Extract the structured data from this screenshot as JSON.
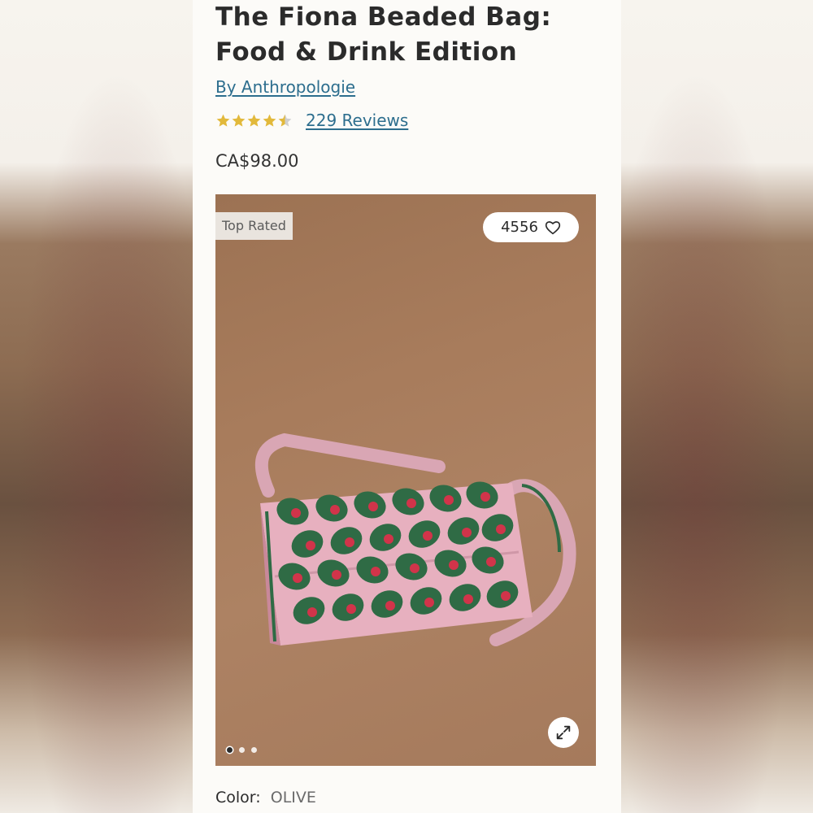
{
  "product": {
    "title_line1": "The Fiona Beaded Bag:",
    "title_line2": "Food & Drink Edition",
    "brand": "By Anthropologie",
    "rating_value": 4.5,
    "rating_max": 5,
    "reviews": "229 Reviews",
    "price": "CA$98.00"
  },
  "image": {
    "badge": "Top Rated",
    "likes": "4556",
    "dots_total": 3,
    "active_dot": 0
  },
  "color": {
    "label": "Color:",
    "value": "OLIVE"
  },
  "colors": {
    "star": "#e2b93b",
    "link": "#2d6e8e",
    "bag_pink": "#e7b0bf",
    "bag_green": "#2f6b45",
    "bag_red": "#d1344a"
  },
  "icons": {
    "star": "star-icon",
    "heart": "heart-icon",
    "expand": "expand-icon"
  }
}
